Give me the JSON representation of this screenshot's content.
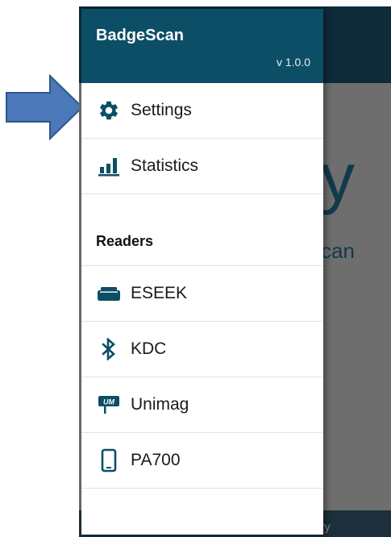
{
  "drawer": {
    "app_title": "BadgeScan",
    "version": "v 1.0.0",
    "items": [
      {
        "label": "Settings",
        "icon": "gear-icon"
      },
      {
        "label": "Statistics",
        "icon": "bar-chart-icon"
      }
    ],
    "readers_heading": "Readers",
    "readers": [
      {
        "label": "ESEEK",
        "icon": "card-reader-icon"
      },
      {
        "label": "KDC",
        "icon": "bluetooth-icon"
      },
      {
        "label": "Unimag",
        "icon": "unimag-icon",
        "icon_text": "UM"
      },
      {
        "label": "PA700",
        "icon": "phone-icon"
      }
    ]
  },
  "background": {
    "big_text": "y",
    "sub_text": "can",
    "footer_text": "ry"
  },
  "colors": {
    "accent": "#0c4e66",
    "arrow_fill": "#4a78b8",
    "arrow_stroke": "#2f5788"
  }
}
